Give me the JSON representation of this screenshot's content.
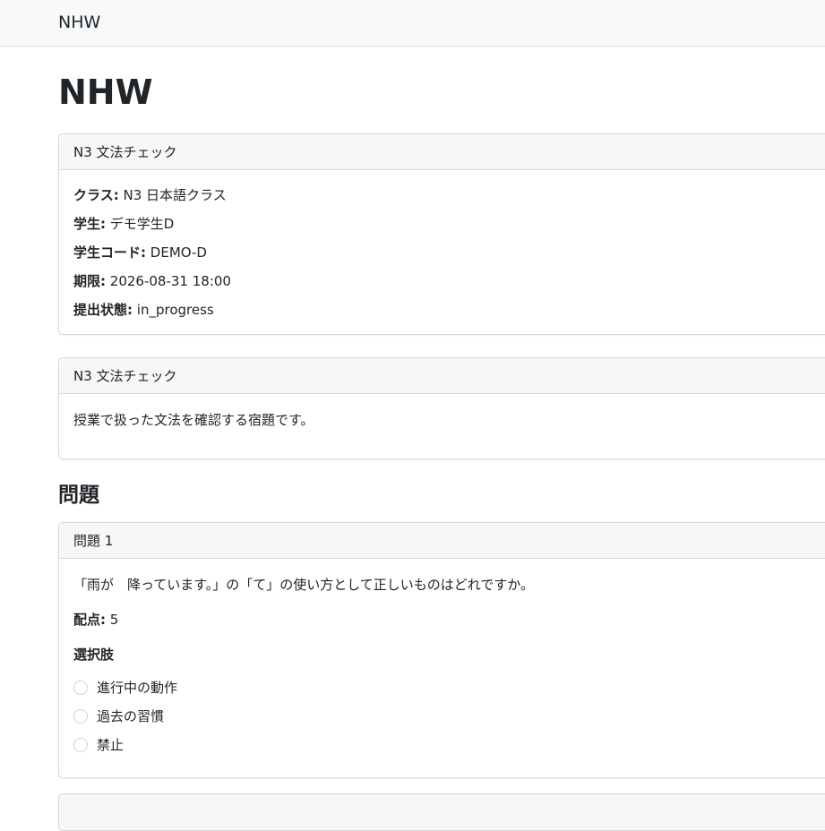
{
  "navbar": {
    "brand": "NHW"
  },
  "page": {
    "title": "NHW"
  },
  "assignment_card": {
    "header": "N3 文法チェック",
    "fields": [
      {
        "label": "クラス",
        "value": "N3 日本語クラス"
      },
      {
        "label": "学生",
        "value": "デモ学生D"
      },
      {
        "label": "学生コード",
        "value": "DEMO-D"
      },
      {
        "label": "期限",
        "value": "2026-08-31 18:00"
      },
      {
        "label": "提出状態",
        "value": "in_progress"
      }
    ]
  },
  "description_card": {
    "header": "N3 文法チェック",
    "body": "授業で扱った文法を確認する宿題です。"
  },
  "questions_section": {
    "title": "問題"
  },
  "questions": [
    {
      "header": "問題 1",
      "text": "「雨が　降っています。」の「て」の使い方として正しいものはどれですか。",
      "points_label": "配点",
      "points_value": "5",
      "choices_label": "選択肢",
      "choices": [
        "進行中の動作",
        "過去の習慣",
        "禁止"
      ]
    }
  ]
}
